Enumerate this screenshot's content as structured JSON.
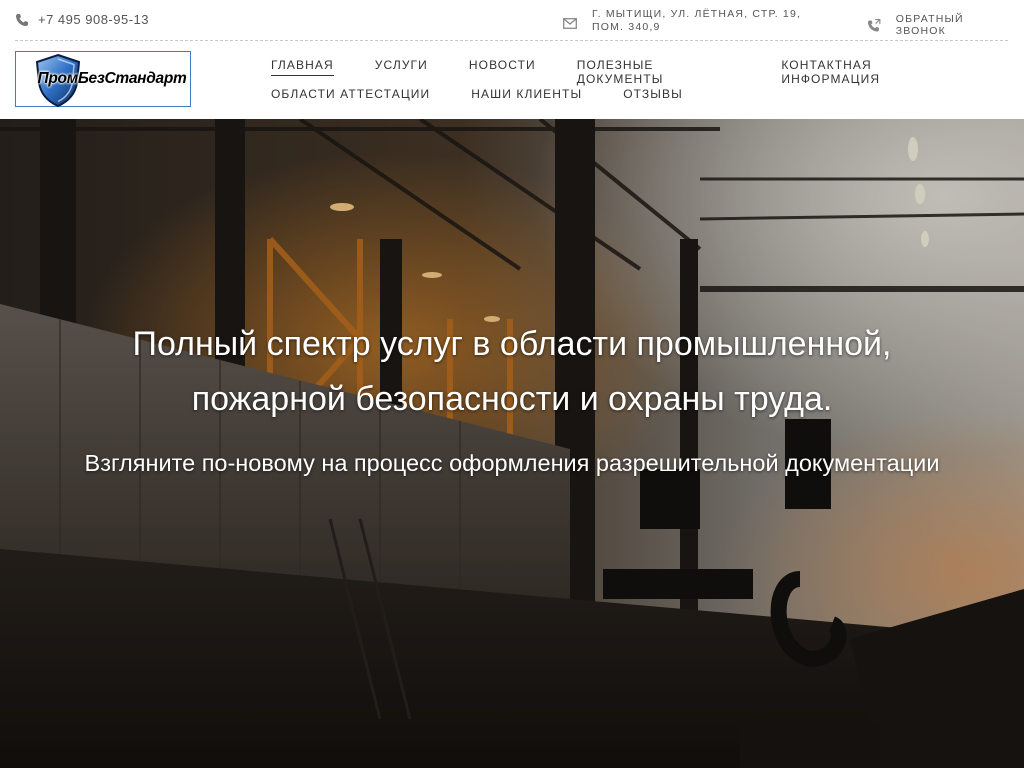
{
  "topbar": {
    "phone": "+7 495 908-95-13",
    "address": "г. Мытищи, ул. Лётная, стр. 19, пом. 340,9",
    "callback": "Обратный звонок"
  },
  "logo": {
    "text": "ПромБезСтандарт"
  },
  "nav": {
    "row1": [
      {
        "label": "Главная",
        "active": true
      },
      {
        "label": "Услуги"
      },
      {
        "label": "Новости"
      },
      {
        "label": "Полезные документы"
      },
      {
        "label": "Контактная информация"
      }
    ],
    "row2": [
      {
        "label": "Области аттестации"
      },
      {
        "label": "Наши клиенты"
      },
      {
        "label": "Отзывы"
      }
    ]
  },
  "hero": {
    "title_line1": "Полный спектр услуг в области промышленной,",
    "title_line2": "пожарной безопасности и охраны труда.",
    "subtitle": "Взгляните по-новому на процесс оформления разрешительной документации"
  },
  "colors": {
    "accent": "#3c7dcc",
    "nav_text": "#333333"
  }
}
